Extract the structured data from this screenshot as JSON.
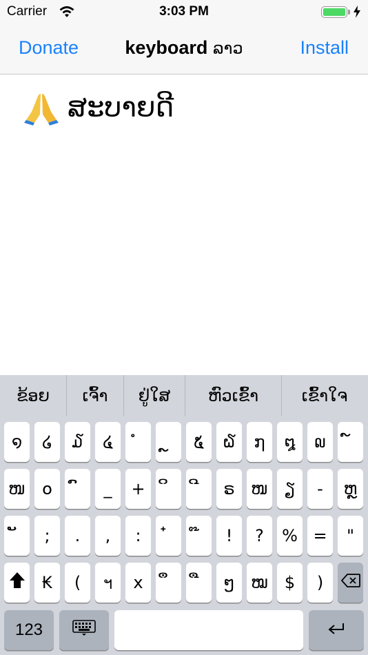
{
  "status_bar": {
    "carrier": "Carrier",
    "time": "3:03 PM",
    "battery_color": "#4cd964"
  },
  "nav": {
    "left_button": "Donate",
    "title": "keyboard",
    "title_lao": "ລາວ",
    "right_button": "Install",
    "accent_color": "#1a82fb"
  },
  "text_area": {
    "emoji_icon": "folded-hands-icon",
    "text": "ສະບາຍດີ"
  },
  "suggestions": [
    "ຂ້ອຍ",
    "ເຈົ້າ",
    "ຢູ່ໃສ",
    "ຫົວເຂົ້າ",
    "ເຂົ້າໃຈ"
  ],
  "keyboard": {
    "rows": [
      [
        "໑",
        "໒",
        "໓",
        "໔",
        "ໍ",
        "ຼ",
        "໕",
        "໖",
        "໗",
        "໘",
        "໙",
        "໌"
      ],
      [
        "ໜ",
        "໐",
        "ົ",
        "_",
        "+",
        "ິ",
        "ີ",
        "ຣ",
        "ໜ",
        "ຽ",
        "-",
        "ຫຼ"
      ],
      [
        "ັ",
        ";",
        ".",
        ",",
        ":",
        "໋",
        "໊",
        "!",
        "?",
        "%",
        "=",
        "\""
      ],
      [
        "₭",
        "(",
        "ฯ",
        "x",
        "ຶ",
        "ື",
        "ໆ",
        "ໝ",
        "$",
        ")"
      ]
    ],
    "shift_icon": "shift-arrow-icon",
    "delete_icon": "backspace-icon",
    "numbers_label": "123",
    "globe_icon": "keyboard-switch-icon",
    "return_icon": "return-arrow-icon"
  }
}
